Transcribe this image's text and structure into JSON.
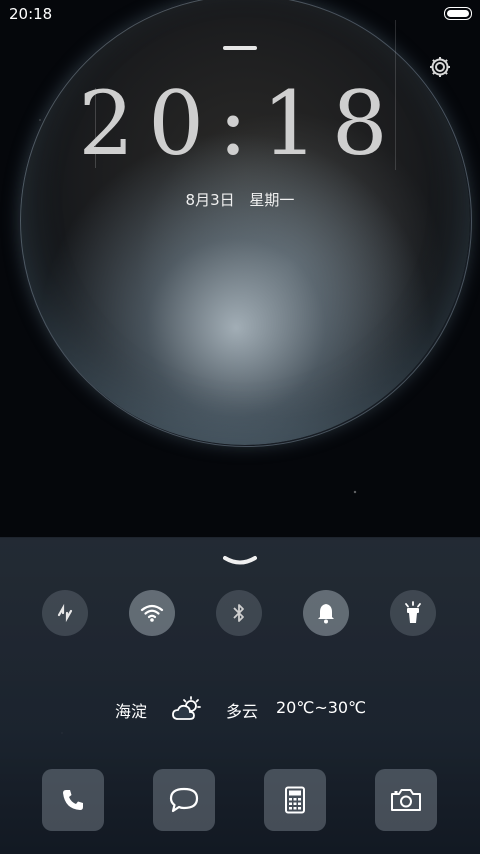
{
  "status_bar": {
    "time": "20:18",
    "battery_icon": "battery-full-icon"
  },
  "lock": {
    "clock": "20:18",
    "date": "8月3日",
    "weekday": "星期一",
    "settings_icon": "gear-icon"
  },
  "quick_toggles": [
    {
      "icon": "sync-icon",
      "on": false
    },
    {
      "icon": "wifi-icon",
      "on": true
    },
    {
      "icon": "bluetooth-icon",
      "on": false
    },
    {
      "icon": "bell-icon",
      "on": true
    },
    {
      "icon": "flashlight-icon",
      "on": false
    }
  ],
  "weather": {
    "location": "海淀",
    "condition": "多云",
    "temperature": "20℃~30℃",
    "icon": "partly-cloudy-icon"
  },
  "dock": [
    {
      "icon": "phone-icon"
    },
    {
      "icon": "message-icon"
    },
    {
      "icon": "calculator-icon"
    },
    {
      "icon": "camera-icon"
    }
  ],
  "colors": {
    "panel": "#2a3644",
    "toggle_on": "#b4bec8",
    "clock_text": "#cfcfcf"
  }
}
